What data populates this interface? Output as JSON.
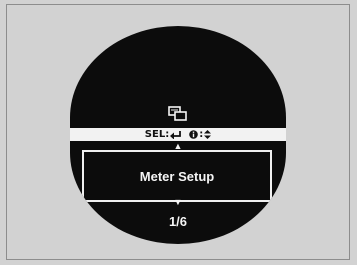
{
  "colors": {
    "background": "#d2d2d2",
    "display": "#0c0c0c",
    "hint_bar": "#f2f2f2",
    "text_light": "#f5f5f5"
  },
  "display": {
    "mode_icon": "menu-mode-icon",
    "hints": {
      "select_label": "SEL:",
      "select_icon": "enter-icon",
      "info_icon": "info-icon",
      "info_arrows": "updown-arrows-icon"
    },
    "menu": {
      "up_arrow": "▲",
      "item_label": "Meter Setup",
      "down_arrow": "▼"
    },
    "page": "1/6"
  }
}
